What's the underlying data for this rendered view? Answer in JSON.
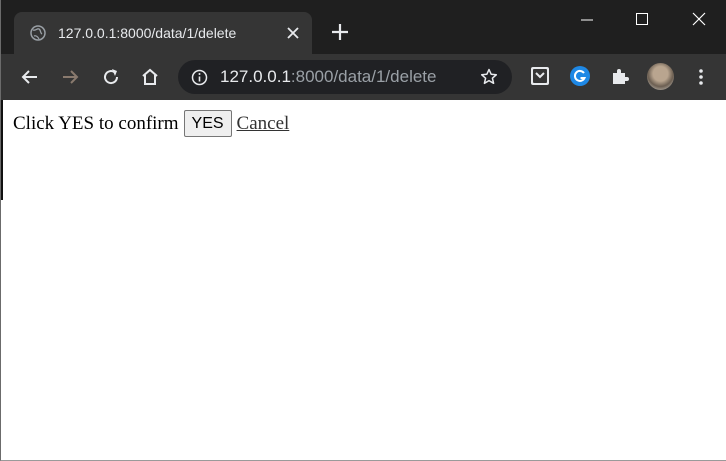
{
  "tab": {
    "title": "127.0.0.1:8000/data/1/delete"
  },
  "omnibox": {
    "host": "127.0.0.1",
    "rest": ":8000/data/1/delete"
  },
  "page": {
    "prompt": "Click YES to confirm",
    "yes_label": "YES",
    "cancel_label": "Cancel"
  },
  "icons": {
    "favicon": "globe-icon",
    "close": "close-icon",
    "new_tab": "plus-icon",
    "back": "back-arrow-icon",
    "forward": "forward-arrow-icon",
    "reload": "reload-icon",
    "home": "home-icon",
    "site_info": "info-icon",
    "bookmark": "star-icon",
    "extensions": [
      "pocket-icon",
      "grammarly-icon",
      "puzzle-icon"
    ],
    "menu": "kebab-menu-icon"
  },
  "colors": {
    "tabstrip": "#1f1f1f",
    "toolbar": "#353535",
    "omnibox": "#202124",
    "grammarly": "#1e88e5"
  }
}
